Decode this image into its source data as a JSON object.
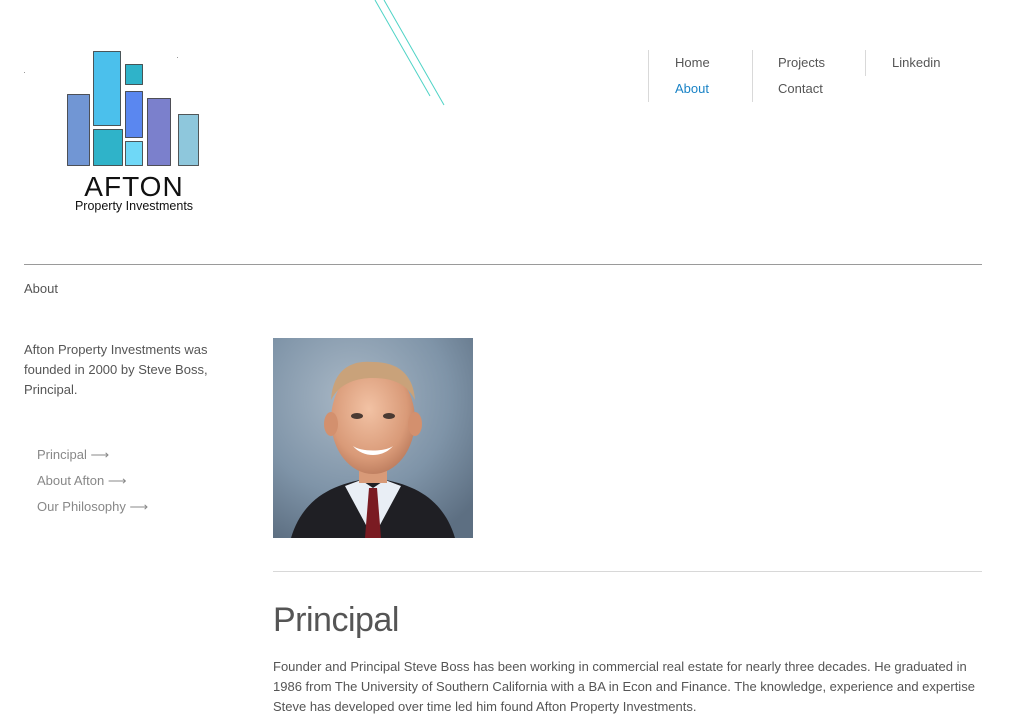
{
  "brand": {
    "logo_text": "AFTON",
    "logo_subtext": "Property Investments",
    "colors": {
      "blue_medium": "#7196d4",
      "sky": "#4bc0ec",
      "teal": "#2fb3c9",
      "royal_blue": "#5a87f0",
      "light_cyan": "#6fd8f7",
      "periwinkle": "#7b80cc",
      "pale_blue": "#8ec7dc",
      "deco_lines": "#4fd3c6"
    }
  },
  "nav": {
    "home": "Home",
    "about": "About",
    "projects": "Projects",
    "contact": "Contact",
    "linkedin": "Linkedin",
    "active_color": "#1a83c6"
  },
  "page": {
    "label": "About",
    "intro": "Afton Property Investments was founded in 2000 by Steve Boss, Principal."
  },
  "subnav": {
    "items": [
      {
        "label": "Principal ⟶"
      },
      {
        "label": "About Afton ⟶"
      },
      {
        "label": "Our Philosophy ⟶"
      }
    ]
  },
  "content": {
    "heading": "Principal",
    "bio": "Founder and Principal Steve Boss has been working in commercial real estate for nearly three decades. He graduated in 1986 from The University of Southern California with a BA in Econ and Finance. The knowledge, experience and expertise Steve has developed over time led him found Afton Property Investments."
  }
}
